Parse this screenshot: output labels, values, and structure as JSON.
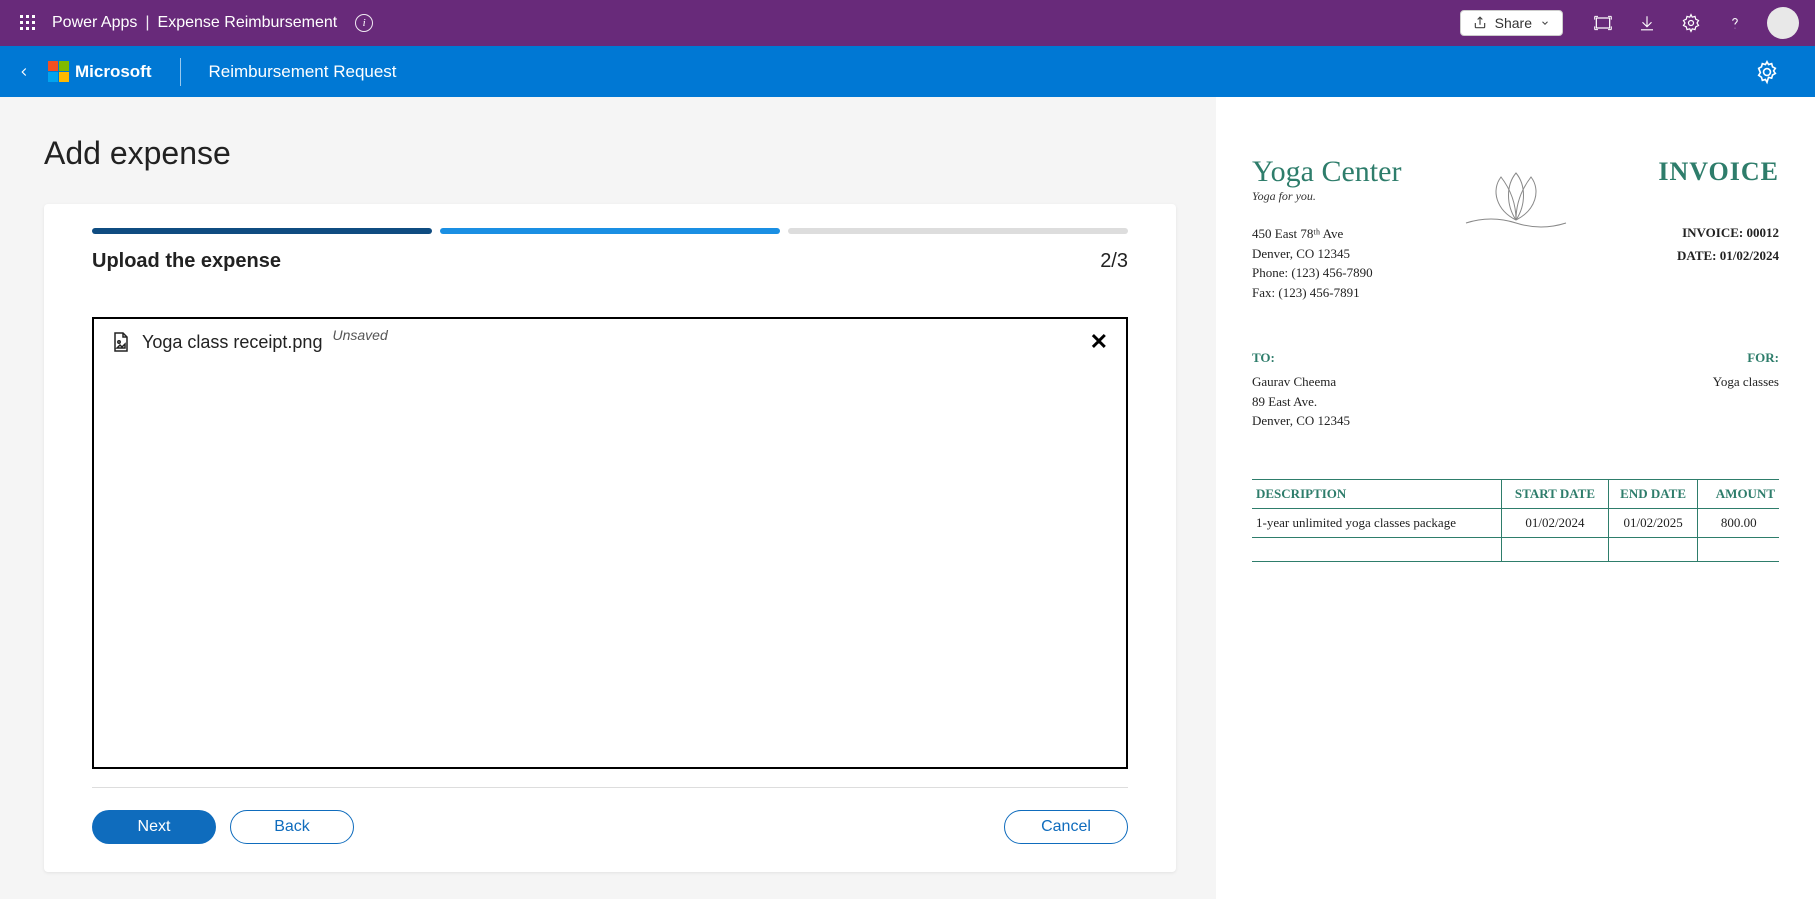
{
  "header": {
    "brand_left": "Power Apps",
    "brand_right": "Expense Reimbursement",
    "share": "Share"
  },
  "appbar": {
    "ms_text": "Microsoft",
    "page_name": "Reimbursement Request"
  },
  "main": {
    "title": "Add expense",
    "step_title": "Upload the expense",
    "step_count": "2/3",
    "file_name": "Yoga class receipt.png",
    "unsaved": "Unsaved",
    "next": "Next",
    "back": "Back",
    "cancel": "Cancel"
  },
  "invoice": {
    "brand": "Yoga Center",
    "tagline": "Yoga for you.",
    "addr_line1": "450 East 78ᵗʰ Ave",
    "addr_line2": "Denver, CO 12345",
    "addr_line3": "Phone: (123) 456-7890",
    "addr_line4": "Fax: (123) 456-7891",
    "title": "INVOICE",
    "meta_invoice": "INVOICE: 00012",
    "meta_date": "DATE: 01/02/2024",
    "to_label": "TO:",
    "to_name": "Gaurav Cheema",
    "to_addr1": "89 East Ave.",
    "to_addr2": "Denver, CO 12345",
    "for_label": "FOR:",
    "for_value": "Yoga classes",
    "th_desc": "DESCRIPTION",
    "th_start": "START DATE",
    "th_end": "END DATE",
    "th_amt": "AMOUNT",
    "row_desc": "1-year unlimited yoga classes package",
    "row_start": "01/02/2024",
    "row_end": "01/02/2025",
    "row_amt": "800.00"
  }
}
